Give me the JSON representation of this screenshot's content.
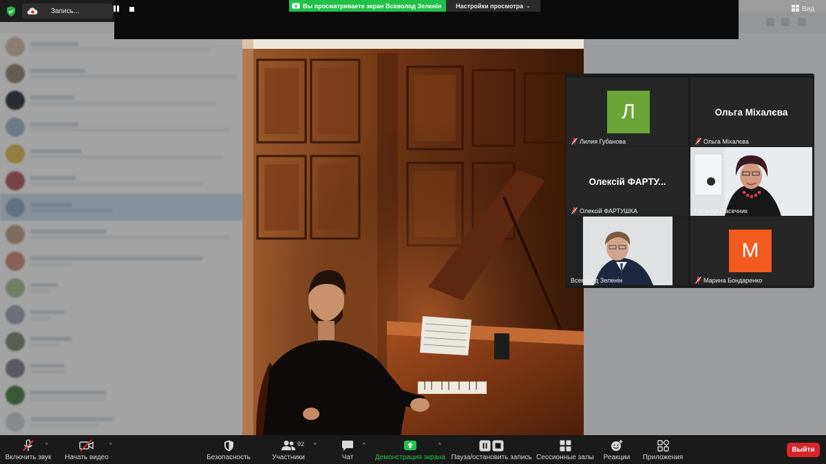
{
  "window": {
    "recording_label": "Запись...",
    "viewing_banner": "Вы просматриваете экран Всеволод Зеленін",
    "view_settings_label": "Настройки просмотра",
    "view_toggle_label": "Вид"
  },
  "gallery": {
    "tiles": [
      {
        "name": "Лилия Губанова",
        "avatar_letter": "Л",
        "avatar_color": "#6aa537",
        "muted": true
      },
      {
        "name": "Ольга Міхалєва",
        "display_name": "Ольга Міхалєва",
        "muted": true
      },
      {
        "name": "Олексій ФАРТУШКА",
        "display_name": "Олексій ФАРТУ...",
        "muted": true
      },
      {
        "name": "Наталья Пасечник",
        "muted": true,
        "active_speaker": true,
        "video": true
      },
      {
        "name": "Всеволод Зеленін",
        "muted": false,
        "video": true
      },
      {
        "name": "Марина Бондаренко",
        "avatar_letter": "М",
        "avatar_color": "#f25a1e",
        "muted": true
      }
    ]
  },
  "toolbar": {
    "mute_label": "Включить звук",
    "video_label": "Начать видео",
    "security_label": "Безопасность",
    "participants_label": "Участники",
    "participants_count": "92",
    "chat_label": "Чат",
    "share_label": "Демонстрация экрана",
    "record_label": "Пауза/остановить запись",
    "breakout_label": "Сессионные залы",
    "reactions_label": "Реакции",
    "apps_label": "Приложения",
    "leave_label": "Выйти"
  },
  "colors": {
    "share_green": "#21c04a",
    "leave_red": "#d6262b",
    "speaker_outline": "#d8e85e"
  }
}
